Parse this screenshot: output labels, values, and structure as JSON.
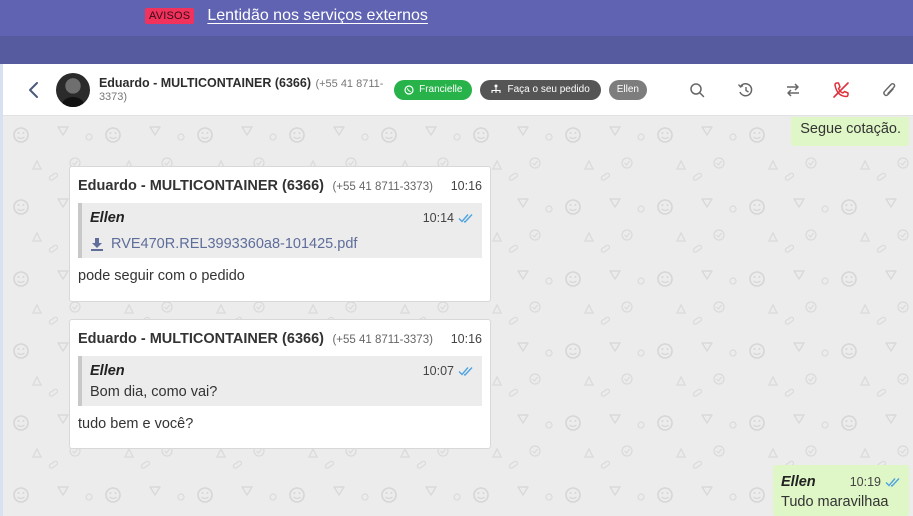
{
  "notice": {
    "badge": "AVISOS",
    "message": "Lentidão nos serviços externos"
  },
  "header": {
    "contact_name": "Eduardo - MULTICONTAINER (6366)",
    "contact_phone": "(+55 41 8711-3373)",
    "tags": [
      {
        "label": "Francielle",
        "icon": "whatsapp-icon",
        "color": "#27b34a"
      },
      {
        "label": "Faça o seu pedido",
        "icon": "flow-icon",
        "color": "#555555"
      },
      {
        "label": "Ellen",
        "color": "#7d7d7d"
      }
    ],
    "icons": [
      "search-icon",
      "history-icon",
      "transfer-icon",
      "end-call-icon",
      "attach-icon"
    ]
  },
  "messages": [
    {
      "direction": "out",
      "text": "Segue cotação."
    },
    {
      "direction": "in",
      "sender": "Eduardo - MULTICONTAINER (6366)",
      "phone": "(+55 41 8711-3373)",
      "time": "10:16",
      "quote": {
        "author": "Ellen",
        "time": "10:14",
        "file": "RVE470R.REL3993360a8-101425.pdf"
      },
      "text": "pode seguir com o pedido"
    },
    {
      "direction": "in",
      "sender": "Eduardo - MULTICONTAINER (6366)",
      "phone": "(+55 41 8711-3373)",
      "time": "10:16",
      "quote": {
        "author": "Ellen",
        "time": "10:07",
        "text": "Bom dia, como vai?"
      },
      "text": "tudo bem e você?"
    },
    {
      "direction": "out",
      "author": "Ellen",
      "time": "10:19",
      "text": "Tudo maravilhaa"
    }
  ],
  "colors": {
    "notice_bg": "#5f63b2",
    "badge_bg": "#f0325d",
    "outgoing_bg": "#dff7c6",
    "read_check": "#4fa3e0",
    "end_call": "#e0303a"
  }
}
